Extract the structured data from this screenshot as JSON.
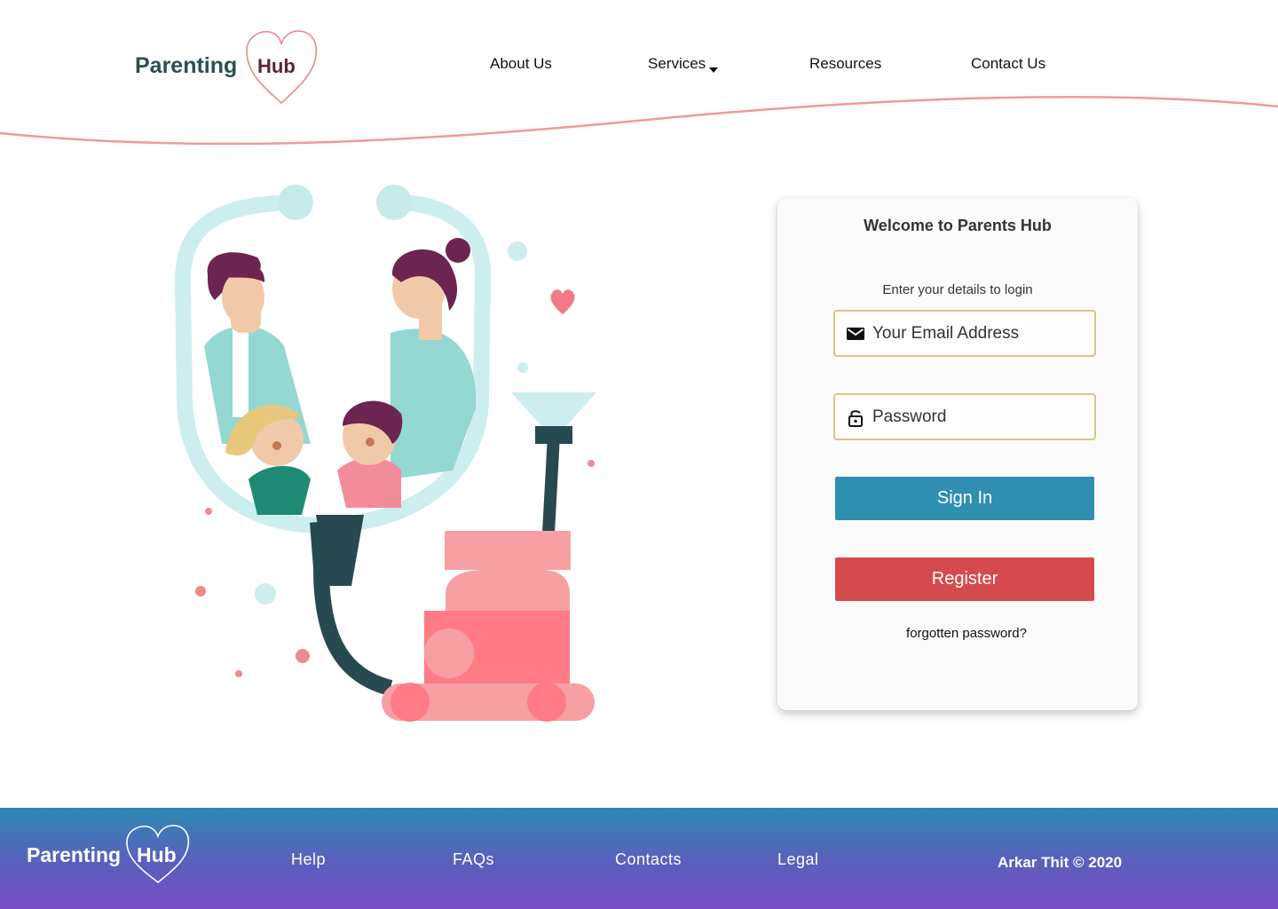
{
  "brand": {
    "word1": "Parenting",
    "word2": "Hub",
    "heart_color": "#e88a8e",
    "text_color": "#2d4f52"
  },
  "nav": {
    "about": "About Us",
    "services": "Services",
    "resources": "Resources",
    "contact": "Contact Us"
  },
  "login": {
    "title": "Welcome to Parents Hub",
    "subtitle": "Enter your details to login",
    "email_placeholder": "Your Email Address",
    "password_placeholder": "Password",
    "signin_label": "Sign In",
    "register_label": "Register",
    "forgot_label": "forgotten password?"
  },
  "footer": {
    "brand_word1": "Parenting",
    "brand_word2": "Hub",
    "links": {
      "help": "Help",
      "faqs": "FAQs",
      "contacts": "Contacts",
      "legal": "Legal"
    },
    "copyright": "Arkar Thit © 2020"
  },
  "colors": {
    "accent_wave": "#f09a9d",
    "signin": "#2f8fb0",
    "register": "#d54a4d",
    "field_border": "#d8c489",
    "footer_top": "#2f8ab4",
    "footer_bottom": "#7a4cc7"
  },
  "icons": [
    "heart-icon",
    "caret-down-icon",
    "mail-icon",
    "lock-icon"
  ]
}
